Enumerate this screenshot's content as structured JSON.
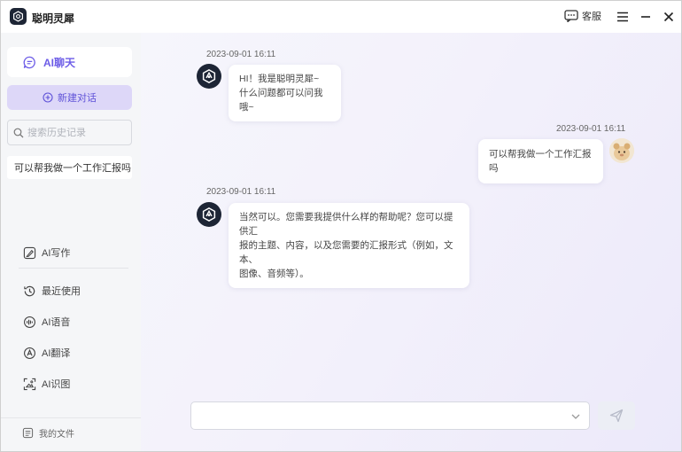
{
  "app": {
    "title": "聪明灵犀"
  },
  "titlebar": {
    "service_label": "客服"
  },
  "sidebar": {
    "chat_label": "AI聊天",
    "new_chat_label": "新建对话",
    "search_placeholder": "搜索历史记录",
    "history": [
      {
        "label": "可以帮我做一个工作汇报吗"
      }
    ],
    "tools": [
      {
        "label": "AI写作",
        "icon": "ai-writing-icon"
      },
      {
        "label": "最近使用",
        "icon": "recent-icon"
      },
      {
        "label": "AI语音",
        "icon": "voice-icon"
      },
      {
        "label": "AI翻译",
        "icon": "translate-icon"
      },
      {
        "label": "AI识图",
        "icon": "image-recognition-icon"
      }
    ],
    "files_label": "我的文件"
  },
  "messages": [
    {
      "role": "bot",
      "time": "2023-09-01 16:11",
      "lines": [
        "HI！我是聪明灵犀~",
        "什么问题都可以问我哦~"
      ]
    },
    {
      "role": "user",
      "time": "2023-09-01 16:11",
      "lines": [
        "可以帮我做一个工作汇报吗"
      ]
    },
    {
      "role": "bot",
      "time": "2023-09-01 16:11",
      "lines": [
        "当然可以。您需要我提供什么样的帮助呢？您可以提供汇",
        "报的主题、内容，以及您需要的汇报形式（例如，文本、",
        "图像、音频等）。"
      ]
    }
  ],
  "input": {
    "value": "",
    "placeholder": ""
  },
  "colors": {
    "accent": "#6c5ce7",
    "accent_light": "#ddd7f8",
    "logo_bg": "#1d2535"
  }
}
